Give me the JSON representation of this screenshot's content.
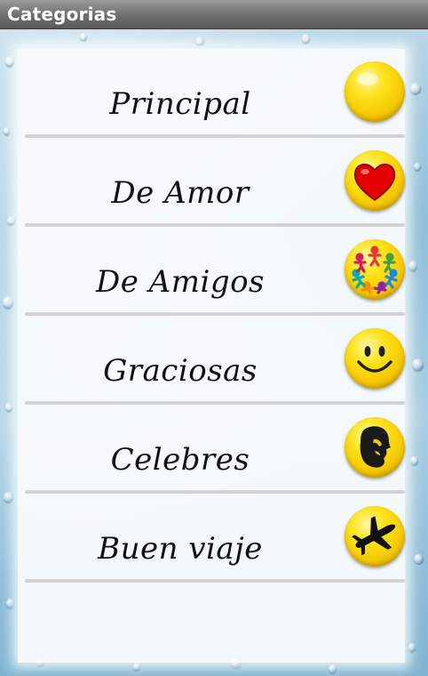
{
  "app": {
    "title": "Categorias"
  },
  "colors": {
    "title_bar": "#6e6e6e",
    "icon_yellow": "#ffe31c",
    "heart_red": "#e00000",
    "divider": "#d3d3d3"
  },
  "categories": [
    {
      "label": "Principal",
      "icon": "yellow-ball-icon"
    },
    {
      "label": "De Amor",
      "icon": "heart-icon"
    },
    {
      "label": "De Amigos",
      "icon": "friends-circle-icon"
    },
    {
      "label": "Graciosas",
      "icon": "smiley-icon"
    },
    {
      "label": "Celebres",
      "icon": "lincoln-profile-icon"
    },
    {
      "label": "Buen viaje",
      "icon": "airplane-icon"
    }
  ]
}
